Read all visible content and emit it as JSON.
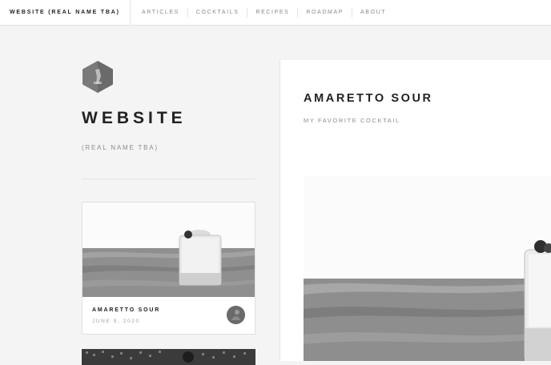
{
  "header": {
    "brand": "WEBSITE (REAL NAME TBA)",
    "nav": [
      "ARTICLES",
      "COCKTAILS",
      "RECIPES",
      "ROADMAP",
      "ABOUT"
    ]
  },
  "sidebar": {
    "logo_icon": "hexagon-logo-icon",
    "title": "WEBSITE",
    "subtitle": "(REAL NAME TBA)"
  },
  "cards": [
    {
      "title": "AMARETTO SOUR",
      "date": "JUNE 9, 2020",
      "image_icon": "cocktail-photo",
      "avatar_icon": "author-avatar"
    }
  ],
  "article": {
    "title": "AMARETTO SOUR",
    "subtitle": "MY FAVORITE COCKTAIL",
    "image_icon": "cocktail-photo"
  },
  "colors": {
    "page_bg": "#f4f4f4",
    "panel_bg": "#ffffff",
    "text_dark": "#222222",
    "text_muted": "#8c8c8c"
  }
}
